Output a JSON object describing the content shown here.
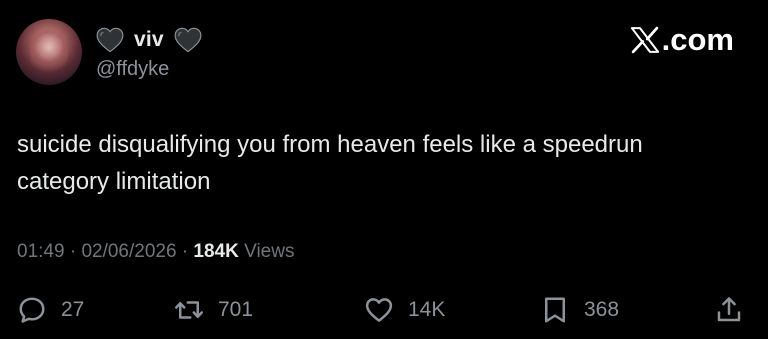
{
  "header": {
    "display_name": "viv",
    "handle": "@ffdyke",
    "brand": ".com",
    "brand_icon": "x-logo-icon",
    "name_emoji_left": "black-heart-icon",
    "name_emoji_right": "black-heart-icon"
  },
  "tweet": {
    "text": "suicide disqualifying you from heaven feels like a speedrun category limitation"
  },
  "meta": {
    "time": "01:49",
    "sep1": " · ",
    "date": "02/06/2026",
    "sep2": " · ",
    "views_count": "184K",
    "views_label": " Views"
  },
  "actions": {
    "replies": "27",
    "reposts": "701",
    "likes": "14K",
    "bookmarks": "368"
  },
  "colors": {
    "background": "#000000",
    "text": "#e7e9ea",
    "muted": "#71767b"
  }
}
